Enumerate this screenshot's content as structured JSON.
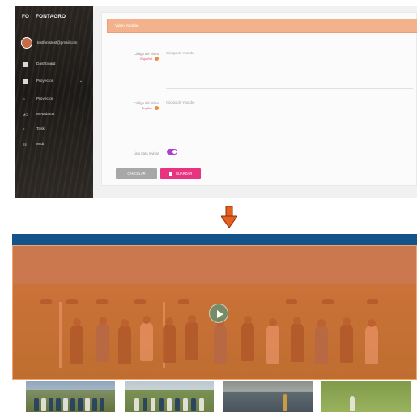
{
  "top_admin": {
    "brand": {
      "abbr": "FO",
      "name": "FONTAGRO"
    },
    "user": {
      "email": "testfontstest@gmail.com"
    },
    "sidebar": {
      "items": [
        {
          "label": "Dashboard",
          "icon": "grid-icon"
        },
        {
          "label": "Proyectos",
          "icon": "folder-icon"
        }
      ],
      "subitems": [
        {
          "abbr": "P",
          "label": "Proyectos"
        },
        {
          "abbr": "MO",
          "label": "Metadatos"
        },
        {
          "abbr": "T",
          "label": "Task"
        },
        {
          "abbr": "TE",
          "label": "Mtdt"
        }
      ]
    },
    "form": {
      "title_placeholder": "Video Youtube",
      "field_1": {
        "label": "Código del Video",
        "sublabel": "Español",
        "placeholder": "Código de Youtube"
      },
      "field_2": {
        "label": "Código del Video",
        "sublabel": "English",
        "placeholder": "Código de Youtube"
      },
      "toggle": {
        "label": "Listo para revisar",
        "state": "on"
      },
      "buttons": {
        "cancel": "CANCELAR",
        "save": "GUARDAR"
      }
    }
  },
  "arrow": {
    "direction": "down",
    "color": "#e65f1f",
    "name": "arrow-down-icon"
  },
  "bottom_media": {
    "hero": {
      "play_icon": "play-icon"
    },
    "thumbnails": [
      "thumbnail-1",
      "thumbnail-2",
      "thumbnail-3",
      "thumbnail-4"
    ]
  },
  "colors": {
    "sidebar_bg": "#231f1c",
    "title_bar": "#f4b28c",
    "save_button": "#e8337f",
    "cancel_button": "#a7a7a7",
    "toggle": "#b03fd0",
    "blue_band": "#13548a",
    "hero_overlay": "#e26828"
  }
}
